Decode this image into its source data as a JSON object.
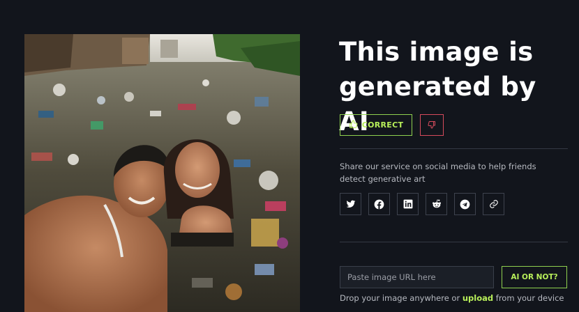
{
  "result": {
    "verdict_line1": "This image is",
    "verdict_line2": "generated by AI"
  },
  "feedback": {
    "correct_label": "CORRECT",
    "correct_icon": "thumbs-up-icon",
    "wrong_icon": "thumbs-down-icon"
  },
  "share": {
    "text": "Share our service on social media to help friends detect generative art",
    "networks": [
      "twitter-icon",
      "facebook-icon",
      "linkedin-icon",
      "reddit-icon",
      "telegram-icon",
      "link-icon"
    ]
  },
  "check": {
    "url_placeholder": "Paste image URL here",
    "button_label": "AI OR NOT?",
    "drop_prefix": "Drop your image anywhere or ",
    "upload_label": "upload",
    "drop_suffix": " from your device"
  },
  "colors": {
    "background": "#12151c",
    "accent_green": "#b8ef5a",
    "accent_red": "#d64b5c"
  }
}
